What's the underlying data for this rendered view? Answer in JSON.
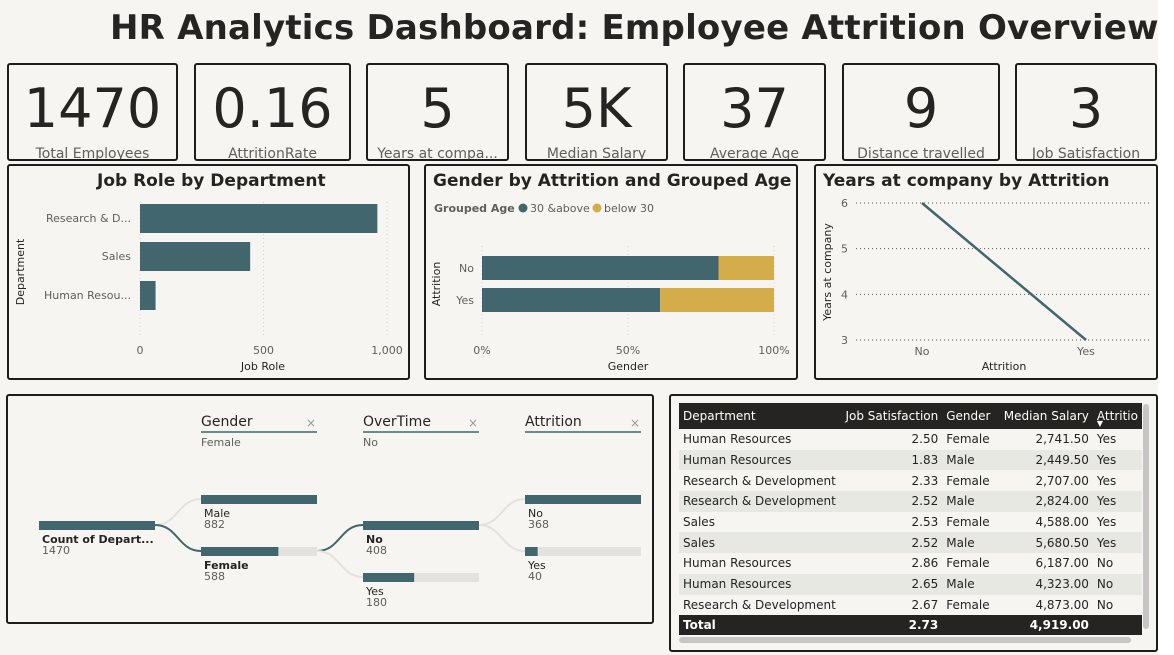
{
  "title": "HR Analytics Dashboard: Employee Attrition Overview",
  "kpis": [
    {
      "value": "1470",
      "label": "Total Employees"
    },
    {
      "value": "0.16",
      "label": "AttritionRate"
    },
    {
      "value": "5",
      "label": "Years at compa..."
    },
    {
      "value": "5K",
      "label": "Median Salary"
    },
    {
      "value": "37",
      "label": "Average Age"
    },
    {
      "value": "9",
      "label": "Distance travelled"
    },
    {
      "value": "3",
      "label": "Job Satisfaction"
    }
  ],
  "colors": {
    "teal": "#41666e",
    "gold": "#d4ad4a",
    "dark": "#252423"
  },
  "chart_data": [
    {
      "type": "bar",
      "title": "Job Role by Department",
      "orientation": "horizontal",
      "xlabel": "Job Role",
      "ylabel": "Department",
      "categories": [
        "Research & D...",
        "Sales",
        "Human Resou..."
      ],
      "values": [
        961,
        446,
        63
      ],
      "xlim": [
        0,
        1000
      ],
      "ticks": [
        "0",
        "500",
        "1,000"
      ]
    },
    {
      "type": "bar",
      "title": "Gender by Attrition and Grouped Age",
      "orientation": "horizontal",
      "stacked": "100%",
      "legend_title": "Grouped Age",
      "xlabel": "Gender",
      "ylabel": "Attrition",
      "categories": [
        "No",
        "Yes"
      ],
      "series": [
        {
          "name": "30 &above",
          "values": [
            81,
            61
          ]
        },
        {
          "name": "below 30",
          "values": [
            19,
            39
          ]
        }
      ],
      "ticks": [
        "0%",
        "50%",
        "100%"
      ]
    },
    {
      "type": "line",
      "title": "Years at company by Attrition",
      "xlabel": "Attrition",
      "ylabel": "Years at company",
      "x": [
        "No",
        "Yes"
      ],
      "y": [
        6,
        3
      ],
      "ylim": [
        3,
        6
      ],
      "yticks": [
        "6",
        "5",
        "4",
        "3"
      ]
    }
  ],
  "decomp": {
    "levels": [
      {
        "label": "Gender",
        "filter": "Female"
      },
      {
        "label": "OverTime",
        "filter": "No"
      },
      {
        "label": "Attrition",
        "filter": ""
      }
    ],
    "root": {
      "label": "Count of Depart...",
      "value": "1470"
    },
    "gender": [
      {
        "label": "Male",
        "value": "882",
        "fraction": 1.0
      },
      {
        "label": "Female",
        "value": "588",
        "fraction": 0.667
      }
    ],
    "overtime": [
      {
        "label": "No",
        "value": "408",
        "fraction": 1.0
      },
      {
        "label": "Yes",
        "value": "180",
        "fraction": 0.441
      }
    ],
    "attrition": [
      {
        "label": "No",
        "value": "368",
        "fraction": 1.0
      },
      {
        "label": "Yes",
        "value": "40",
        "fraction": 0.109
      }
    ]
  },
  "table": {
    "headers": [
      "Department",
      "Job Satisfaction",
      "Gender",
      "Median Salary",
      "Attritio"
    ],
    "rows": [
      [
        "Human Resources",
        "2.50",
        "Female",
        "2,741.50",
        "Yes"
      ],
      [
        "Human Resources",
        "1.83",
        "Male",
        "2,449.50",
        "Yes"
      ],
      [
        "Research & Development",
        "2.33",
        "Female",
        "2,707.00",
        "Yes"
      ],
      [
        "Research & Development",
        "2.52",
        "Male",
        "2,824.00",
        "Yes"
      ],
      [
        "Sales",
        "2.53",
        "Female",
        "4,588.00",
        "Yes"
      ],
      [
        "Sales",
        "2.52",
        "Male",
        "5,680.50",
        "Yes"
      ],
      [
        "Human Resources",
        "2.86",
        "Female",
        "6,187.00",
        "No"
      ],
      [
        "Human Resources",
        "2.65",
        "Male",
        "4,323.00",
        "No"
      ],
      [
        "Research & Development",
        "2.67",
        "Female",
        "4,873.00",
        "No"
      ]
    ],
    "total": [
      "Total",
      "2.73",
      "",
      "4,919.00",
      ""
    ]
  }
}
